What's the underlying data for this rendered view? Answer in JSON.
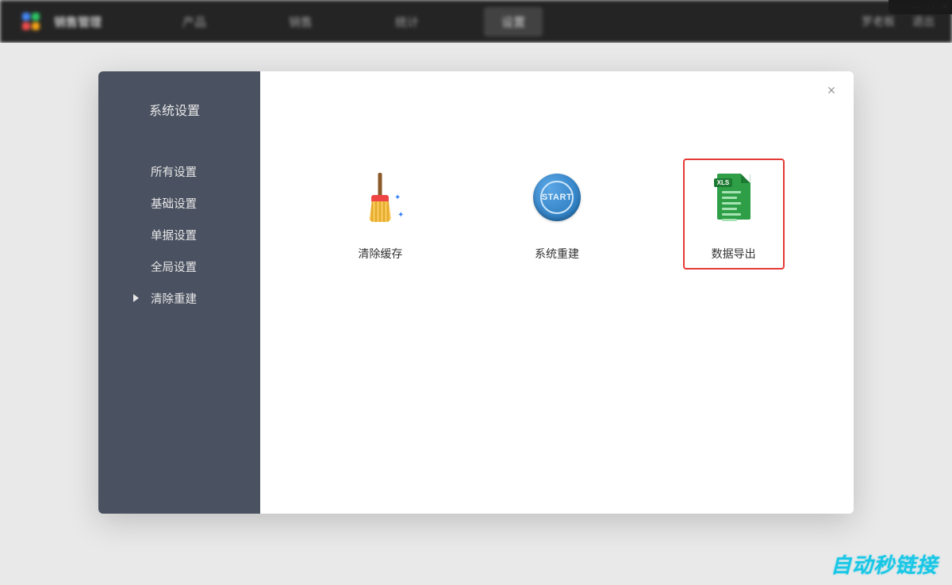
{
  "window_controls": {
    "minimize": "—",
    "maximize": "□",
    "close": "✕"
  },
  "nav": {
    "brand": "销售管理",
    "items": [
      {
        "label": "产品",
        "active": false
      },
      {
        "label": "销售",
        "active": false
      },
      {
        "label": "统计",
        "active": false
      },
      {
        "label": "设置",
        "active": true
      }
    ],
    "user": "罗老板",
    "logout": "退出"
  },
  "modal": {
    "title": "系统设置",
    "close_symbol": "×",
    "sidebar": [
      {
        "label": "所有设置",
        "current": false
      },
      {
        "label": "基础设置",
        "current": false
      },
      {
        "label": "单据设置",
        "current": false
      },
      {
        "label": "全局设置",
        "current": false
      },
      {
        "label": "清除重建",
        "current": true
      }
    ],
    "options": [
      {
        "label": "清除缓存",
        "icon": "broom",
        "selected": false
      },
      {
        "label": "系统重建",
        "icon": "start",
        "selected": false,
        "icon_text": "START"
      },
      {
        "label": "数据导出",
        "icon": "xls",
        "selected": true,
        "icon_text": "XLS"
      }
    ]
  },
  "watermark": "自动秒链接"
}
